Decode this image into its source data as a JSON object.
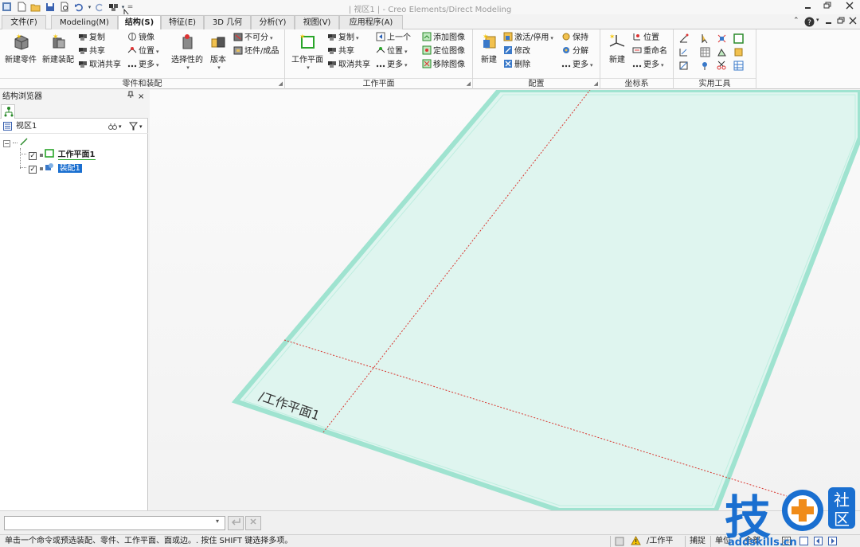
{
  "window": {
    "title": "| 视区1 | - Creo Elements/Direct Modeling",
    "qat_more": "="
  },
  "menu_tabs": [
    {
      "label": "文件(F)"
    },
    {
      "label": "Modeling(M)"
    },
    {
      "label": "结构(S)"
    },
    {
      "label": "特征(E)"
    },
    {
      "label": "3D 几何"
    },
    {
      "label": "分析(Y)"
    },
    {
      "label": "视图(V)"
    },
    {
      "label": "应用程序(A)"
    }
  ],
  "ribbon": {
    "parts": {
      "label": "零件和装配",
      "new_part": "新建零件",
      "new_assembly": "新建装配",
      "copy": "复制",
      "share": "共享",
      "unshare": "取消共享",
      "mirror": "镜像",
      "position": "位置",
      "more": "更多",
      "select": "选择性的",
      "version": "版本",
      "indivisible": "不可分",
      "stock": "坯件/成品"
    },
    "workplane": {
      "label": "工作平面",
      "wp_btn": "工作平面",
      "copy": "复制",
      "share": "共享",
      "unshare": "取消共享",
      "prev": "上一个",
      "position": "位置",
      "more": "更多",
      "add_image": "添加图像",
      "place_image": "定位图像",
      "remove_image": "移除图像"
    },
    "config": {
      "label": "配置",
      "new": "新建",
      "activate": "激活/停用",
      "modify": "修改",
      "delete": "删除",
      "keep": "保持",
      "decompose": "分解",
      "more": "更多"
    },
    "coord": {
      "label": "坐标系",
      "new": "新建",
      "position": "位置",
      "rename": "重命名",
      "more": "更多"
    },
    "util": {
      "label": "实用工具"
    }
  },
  "browser": {
    "title": "结构浏览器",
    "pin": "ᵖ",
    "close": "×",
    "viewport": "视区1",
    "tree": [
      {
        "label": "工作平面1",
        "checked": true
      },
      {
        "label": "装配1",
        "checked": true,
        "selected": true
      }
    ]
  },
  "viewport": {
    "workplane_label": "/工作平面1"
  },
  "cmdline": {
    "value": ""
  },
  "status": {
    "message": "单击一个命令或预选装配、零件、工作平面、面或边。. 按住 SHIFT 键选择多项。",
    "wp": "/工作平",
    "snap": "捕捉",
    "units": "单位",
    "all": "全部"
  },
  "watermark": {
    "text": "技",
    "sub1": "社",
    "sub2": "区",
    "url": "addskills.cn"
  },
  "colors": {
    "accent_blue": "#1a6fd0",
    "plane_fill": "#dff5ef",
    "plane_edge": "#9fe3d0",
    "axis_red": "#d8352e"
  }
}
